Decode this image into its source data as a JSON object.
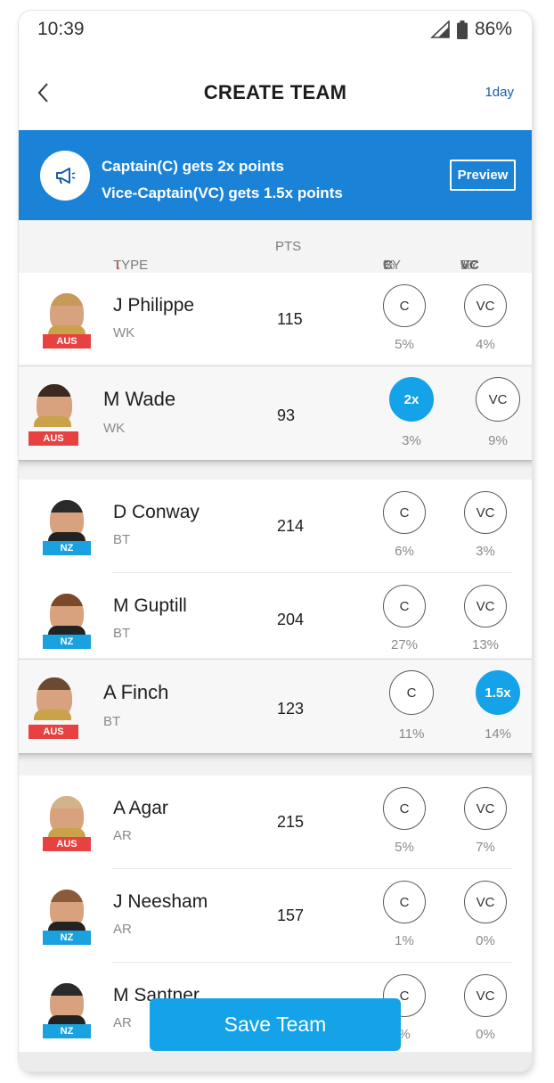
{
  "status_bar": {
    "time": "10:39",
    "battery": "86%"
  },
  "header": {
    "title": "CREATE TEAM",
    "time_left": "1day"
  },
  "banner": {
    "line1": "Captain(C) gets 2x points",
    "line2": "Vice-Captain(VC) gets 1.5x points",
    "preview_label": "Preview"
  },
  "list_header": {
    "type": "TYPE",
    "sort_arrow": "↓",
    "pts": "PTS",
    "c_by_prefix": "%",
    "c_by_key": "C",
    "c_by_suffix": "BY",
    "vc_by_prefix": "%",
    "vc_by_key": "VC",
    "vc_by_suffix": "BY"
  },
  "players": [
    {
      "name": "J Philippe",
      "role": "WK",
      "team": "AUS",
      "pts": "115",
      "c_label": "C",
      "vc_label": "VC",
      "c_pct": "5%",
      "vc_pct": "4%"
    },
    {
      "name": "M Wade",
      "role": "WK",
      "team": "AUS",
      "pts": "93",
      "c_label": "2x",
      "vc_label": "VC",
      "c_pct": "3%",
      "vc_pct": "9%",
      "selected": "captain"
    },
    {
      "name": "D Conway",
      "role": "BT",
      "team": "NZ",
      "pts": "214",
      "c_label": "C",
      "vc_label": "VC",
      "c_pct": "6%",
      "vc_pct": "3%"
    },
    {
      "name": "M Guptill",
      "role": "BT",
      "team": "NZ",
      "pts": "204",
      "c_label": "C",
      "vc_label": "VC",
      "c_pct": "27%",
      "vc_pct": "13%"
    },
    {
      "name": "A Finch",
      "role": "BT",
      "team": "AUS",
      "pts": "123",
      "c_label": "C",
      "vc_label": "1.5x",
      "c_pct": "11%",
      "vc_pct": "14%",
      "selected": "vice_captain"
    },
    {
      "name": "A Agar",
      "role": "AR",
      "team": "AUS",
      "pts": "215",
      "c_label": "C",
      "vc_label": "VC",
      "c_pct": "5%",
      "vc_pct": "7%"
    },
    {
      "name": "J Neesham",
      "role": "AR",
      "team": "NZ",
      "pts": "157",
      "c_label": "C",
      "vc_label": "VC",
      "c_pct": "1%",
      "vc_pct": "0%"
    },
    {
      "name": "M Santner",
      "role": "AR",
      "team": "NZ",
      "pts": "",
      "c_label": "C",
      "vc_label": "VC",
      "c_pct": "%",
      "vc_pct": "0%"
    }
  ],
  "save_label": "Save Team",
  "colors": {
    "accent": "#14a3e8",
    "banner": "#1a83d8",
    "aus": "#e84141",
    "nz": "#1aa2e0"
  },
  "icons": [
    "signal-icon",
    "battery-icon",
    "back-icon",
    "megaphone-icon"
  ]
}
